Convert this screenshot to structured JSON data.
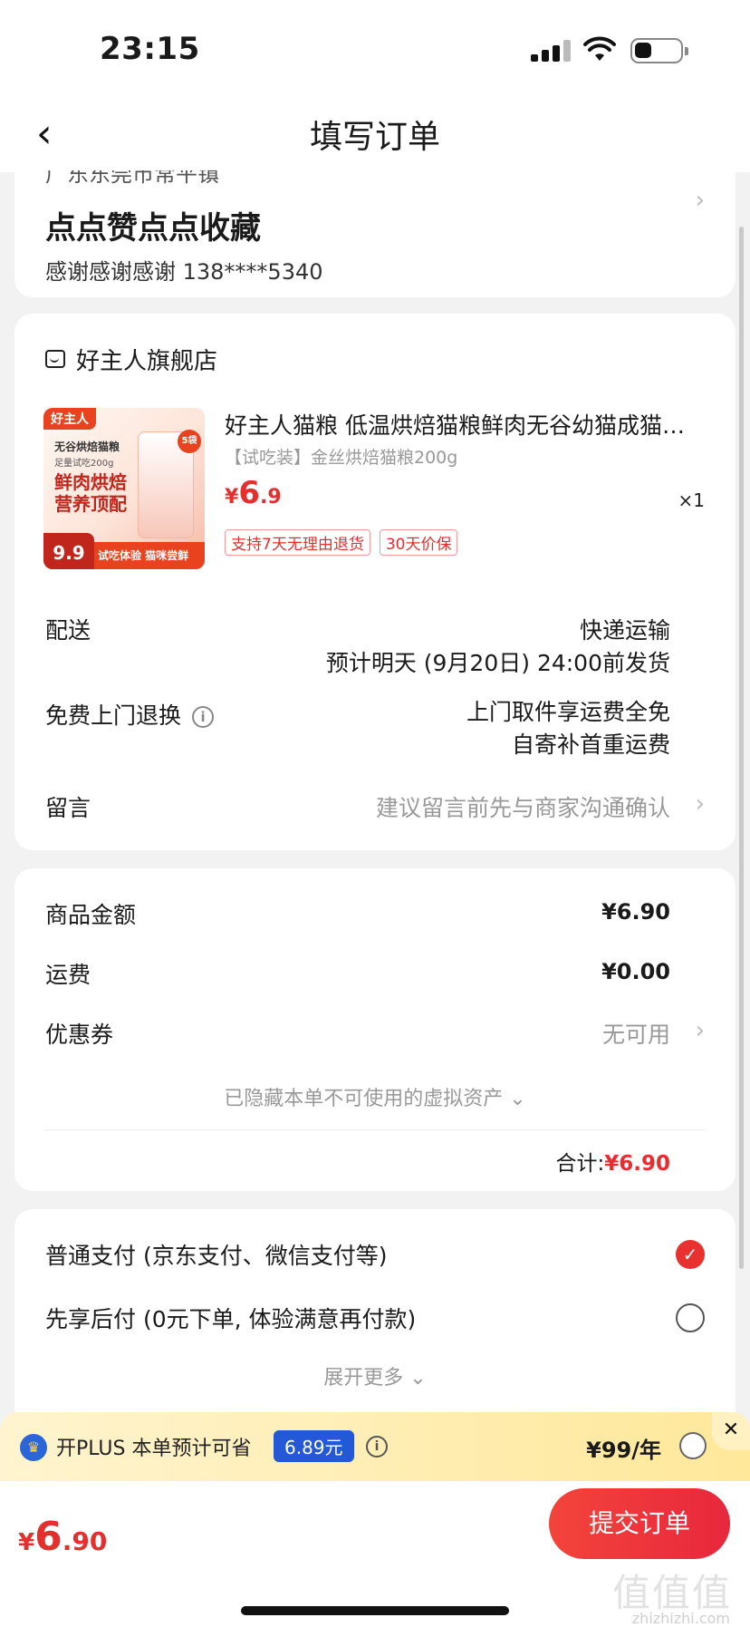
{
  "status": {
    "time": "23:15"
  },
  "nav": {
    "title": "填写订单"
  },
  "address": {
    "region": "广东东莞市常平镇",
    "name": "点点赞点点收藏",
    "contact": "感谢感谢感谢  138****5340"
  },
  "store": {
    "name": "好主人旗舰店"
  },
  "product": {
    "image_brand": "好主人",
    "image_line1": "无谷烘焙猫粮",
    "image_line2": "足量试吃200g",
    "image_headline": "鲜肉烘焙 营养顶配",
    "image_bottom": "试吃体验 猫咪尝鲜",
    "image_price": "9.9",
    "image_badge": "5袋",
    "title": "好主人猫粮 低温烘焙猫粮鲜肉无谷幼猫成猫…",
    "spec": "【试吃装】金丝烘焙猫粮200g",
    "price_symbol": "¥",
    "price_int": "6",
    "price_dec": ".9",
    "qty": "×1",
    "tags": [
      "支持7天无理由退货",
      "30天价保"
    ]
  },
  "delivery": {
    "label": "配送",
    "method": "快递运输",
    "eta": "预计明天 (9月20日) 24:00前发货"
  },
  "return": {
    "label": "免费上门退换",
    "line1": "上门取件享运费全免",
    "line2": "自寄补首重运费"
  },
  "message": {
    "label": "留言",
    "placeholder": "建议留言前先与商家沟通确认"
  },
  "amounts": {
    "goods_label": "商品金额",
    "goods_value": "¥6.90",
    "shipping_label": "运费",
    "shipping_value": "¥0.00",
    "coupon_label": "优惠券",
    "coupon_value": "无可用",
    "hidden_note": "已隐藏本单不可使用的虚拟资产 ⌄",
    "total_label": "合计:",
    "total_value": "¥6.90"
  },
  "payment": {
    "option1": "普通支付 (京东支付、微信支付等)",
    "option2": "先享后付 (0元下单, 体验满意再付款)",
    "expand": "展开更多 ⌄"
  },
  "plus": {
    "text": "开PLUS 本单预计可省",
    "save": "6.89元",
    "price": "¥99/年"
  },
  "bottom": {
    "price_symbol": "¥",
    "price_int": "6",
    "price_dec": ".90",
    "submit": "提交订单",
    "watermark": "值值值",
    "watermark_sub": "zhizhizhi.com"
  },
  "colors": {
    "accent": "#e52e2e",
    "plus_blue": "#2558d6",
    "plus_bg": "#ffe89a"
  }
}
